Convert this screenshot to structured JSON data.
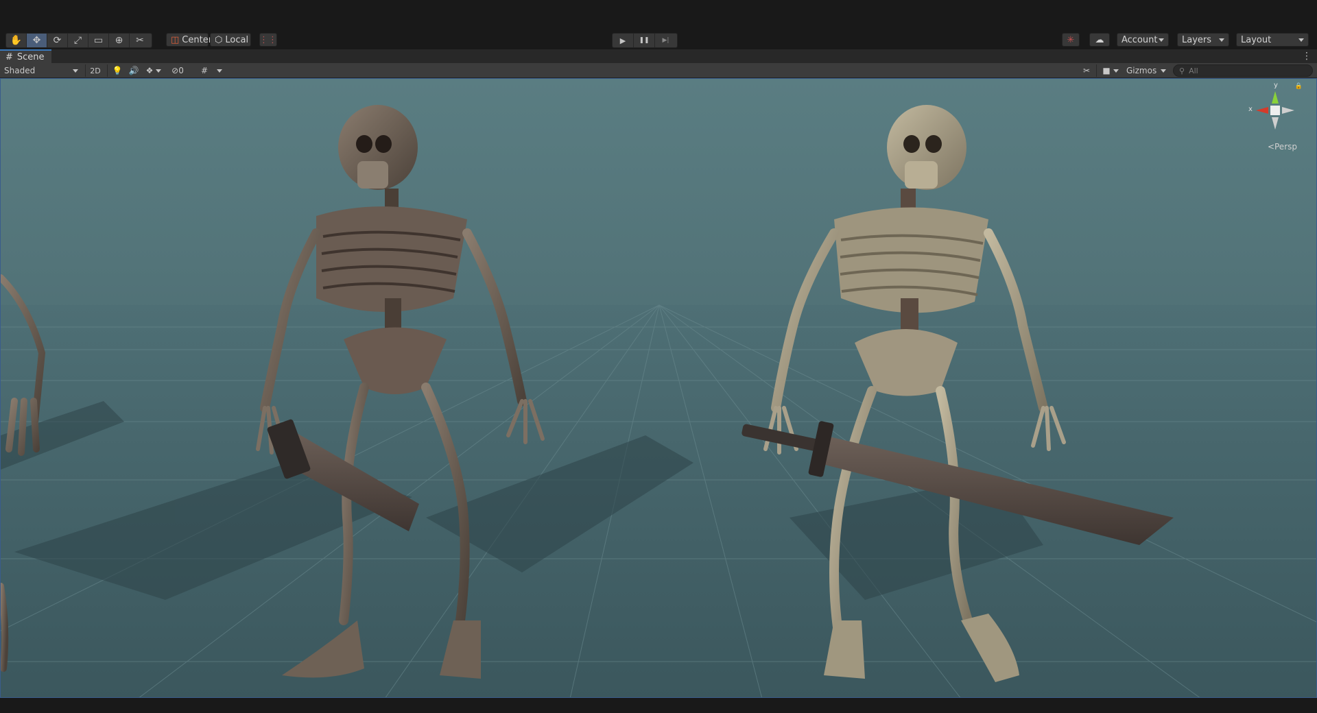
{
  "toolbar": {
    "tools": [
      {
        "name": "hand-tool-icon",
        "glyph": "✋"
      },
      {
        "name": "move-tool-icon",
        "glyph": "✥",
        "active": true
      },
      {
        "name": "rotate-tool-icon",
        "glyph": "⟳"
      },
      {
        "name": "scale-tool-icon",
        "glyph": "⤢"
      },
      {
        "name": "rect-tool-icon",
        "glyph": "▭"
      },
      {
        "name": "transform-tool-icon",
        "glyph": "⊕"
      },
      {
        "name": "custom-tool-icon",
        "glyph": "✂"
      }
    ],
    "pivot_label": "Center",
    "pivot_rotation_label": "Local",
    "snap_icon": "grid-snap-icon",
    "play_icon": "▶",
    "pause_icon": "❚❚",
    "step_icon": "▶|",
    "collab_icon": "collab-icon",
    "cloud_icon": "cloud-icon",
    "account_label": "Account",
    "layers_label": "Layers",
    "layout_label": "Layout"
  },
  "tab": {
    "icon": "#",
    "label": "Scene",
    "menu_icon": "⋮"
  },
  "scenebar": {
    "draw_mode": "Shaded",
    "mode_2d": "2D",
    "light_icon": "light-bulb-icon",
    "audio_icon": "audio-icon",
    "effects_icon": "effects-icon",
    "hidden_count": "0",
    "grid_icon": "grid-icon",
    "tools_icon": "tools-icon",
    "camera_icon": "camera-icon",
    "gizmos_label": "Gizmos",
    "search_placeholder": "All"
  },
  "viewport": {
    "projection_label": "Persp",
    "axis_x": "x",
    "axis_y": "y",
    "colors": {
      "sky": "#5a7d82",
      "ground": "#3f5b61",
      "bone_dark": "#6e6155",
      "bone_light": "#a39a85",
      "blade": "#5d5048"
    }
  }
}
